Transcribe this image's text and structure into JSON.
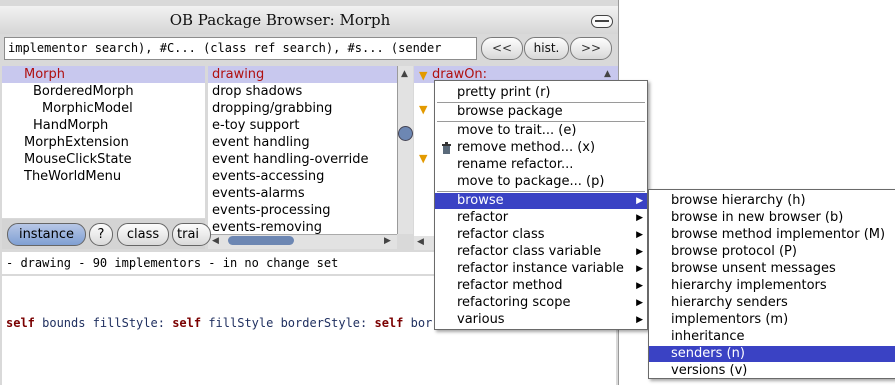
{
  "window": {
    "title": "OB Package Browser: Morph"
  },
  "search": {
    "value": "implementor search), #C... (class ref search), #s... (sender",
    "back_label": "<<",
    "history_label": "hist.",
    "forward_label": ">>"
  },
  "class_list": [
    {
      "label": "Morph",
      "selected": true
    },
    {
      "label": "BorderedMorph",
      "selected": false
    },
    {
      "label": "MorphicModel",
      "selected": false
    },
    {
      "label": "HandMorph",
      "selected": false
    },
    {
      "label": "MorphExtension",
      "selected": false
    },
    {
      "label": "MouseClickState",
      "selected": false
    },
    {
      "label": "TheWorldMenu",
      "selected": false
    }
  ],
  "category_list": [
    {
      "label": "drawing",
      "selected": true
    },
    {
      "label": "drop shadows",
      "selected": false
    },
    {
      "label": "dropping/grabbing",
      "selected": false
    },
    {
      "label": "e-toy support",
      "selected": false
    },
    {
      "label": "event handling",
      "selected": false
    },
    {
      "label": "event handling-override",
      "selected": false
    },
    {
      "label": "events-accessing",
      "selected": false
    },
    {
      "label": "events-alarms",
      "selected": false
    },
    {
      "label": "events-processing",
      "selected": false
    },
    {
      "label": "events-removing",
      "selected": false
    }
  ],
  "method_list": {
    "selected": "drawOn:",
    "marker_icon": "triangle-down-icon"
  },
  "toggles": {
    "instance_label": "instance",
    "help_label": "?",
    "class_label": "class",
    "traits_label": "trai"
  },
  "status": {
    "text": "- drawing - 90 implementors - in no change set"
  },
  "code": {
    "kw_self1": "self",
    "t1": " bounds fillStyle: ",
    "kw_self2": "self",
    "t2": " fillStyle borderStyle: ",
    "kw_self3": "self",
    "t3": " bor"
  },
  "method_menu": {
    "items": [
      {
        "label": "pretty print (r)"
      },
      {
        "label": "browse package"
      },
      {
        "label": "move to trait... (e)"
      },
      {
        "label": "remove method... (x)",
        "icon": "trash-icon"
      },
      {
        "label": "rename refactor..."
      },
      {
        "label": "move to package... (p)"
      },
      {
        "label": "browse",
        "submenu": true,
        "highlighted": true
      },
      {
        "label": "refactor",
        "submenu": true
      },
      {
        "label": "refactor class",
        "submenu": true
      },
      {
        "label": "refactor class variable",
        "submenu": true
      },
      {
        "label": "refactor instance variable",
        "submenu": true
      },
      {
        "label": "refactor method",
        "submenu": true
      },
      {
        "label": "refactoring scope",
        "submenu": true
      },
      {
        "label": "various",
        "submenu": true
      }
    ]
  },
  "browse_submenu": {
    "items": [
      {
        "label": "browse hierarchy (h)"
      },
      {
        "label": "browse in new browser (b)"
      },
      {
        "label": "browse method implementor (M)"
      },
      {
        "label": "browse protocol (P)"
      },
      {
        "label": "browse unsent messages"
      },
      {
        "label": "hierarchy implementors"
      },
      {
        "label": "hierarchy senders"
      },
      {
        "label": "implementors (m)"
      },
      {
        "label": "inheritance"
      },
      {
        "label": "senders (n)",
        "highlighted": true
      },
      {
        "label": "versions (v)"
      }
    ]
  },
  "colors": {
    "selection": "#c8c8ee",
    "menu_highlight": "#3a42c4",
    "selected_text": "#b01010"
  }
}
